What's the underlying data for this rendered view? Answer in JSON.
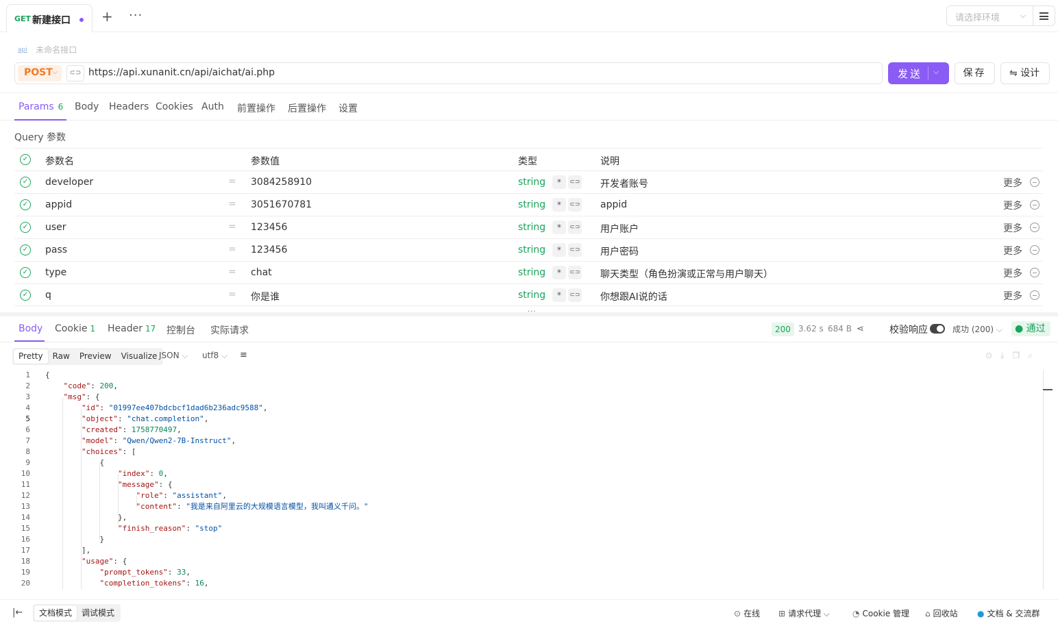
{
  "top_tabs": {
    "active": {
      "method": "GET",
      "title": "新建接口"
    },
    "add": "+",
    "more": "···"
  },
  "environment": {
    "placeholder": "请选择环境"
  },
  "api_name": {
    "tag": "api",
    "placeholder": "未命名接口"
  },
  "request": {
    "method": "POST",
    "url": "https://api.xunanit.cn/api/aichat/ai.php",
    "send_label": "发送",
    "save_label": "保存",
    "design_label": "⇋ 设计"
  },
  "param_tabs": [
    {
      "label": "Params",
      "count": "6"
    },
    {
      "label": "Body"
    },
    {
      "label": "Headers"
    },
    {
      "label": "Cookies"
    },
    {
      "label": "Auth"
    },
    {
      "label": "前置操作"
    },
    {
      "label": "后置操作"
    },
    {
      "label": "设置"
    }
  ],
  "query": {
    "title": "Query 参数",
    "headers": {
      "name": "参数名",
      "value": "参数值",
      "type": "类型",
      "desc": "说明"
    },
    "more_label": "更多",
    "rows": [
      {
        "name": "developer",
        "value": "3084258910",
        "type": "string",
        "desc": "开发者账号"
      },
      {
        "name": "appid",
        "value": "3051670781",
        "type": "string",
        "desc": "appid"
      },
      {
        "name": "user",
        "value": "123456",
        "type": "string",
        "desc": "用户账户"
      },
      {
        "name": "pass",
        "value": "123456",
        "type": "string",
        "desc": "用户密码"
      },
      {
        "name": "type",
        "value": "chat",
        "type": "string",
        "desc": "聊天类型（角色扮演或正常与用户聊天）"
      },
      {
        "name": "q",
        "value": "你是谁",
        "type": "string",
        "desc": "你想跟AI说的话"
      }
    ]
  },
  "response_tabs": [
    {
      "label": "Body"
    },
    {
      "label": "Cookie",
      "count": "1"
    },
    {
      "label": "Header",
      "count": "17"
    },
    {
      "label": "控制台"
    },
    {
      "label": "实际请求"
    }
  ],
  "response_meta": {
    "status": "200",
    "time": "3.62 s",
    "size": "684 B",
    "validate_label": "校验响应",
    "success_select": "成功 (200)",
    "pass_label": "通过"
  },
  "view_modes": [
    "Pretty",
    "Raw",
    "Preview",
    "Visualize"
  ],
  "format": "JSON",
  "encoding": "utf8",
  "code_lines": [
    "{",
    "    \"code\": 200,",
    "    \"msg\": {",
    "        \"id\": \"01997ee407bdcbcf1dad6b236adc9588\",",
    "        \"object\": \"chat.completion\",",
    "        \"created\": 1758770497,",
    "        \"model\": \"Qwen/Qwen2-7B-Instruct\",",
    "        \"choices\": [",
    "            {",
    "                \"index\": 0,",
    "                \"message\": {",
    "                    \"role\": \"assistant\",",
    "                    \"content\": \"我是来自阿里云的大规模语言模型，我叫通义千问。\"",
    "                },",
    "                \"finish_reason\": \"stop\"",
    "            }",
    "        ],",
    "        \"usage\": {",
    "            \"prompt_tokens\": 33,",
    "            \"completion_tokens\": 16,"
  ],
  "footer": {
    "modes": [
      "文档模式",
      "调试模式"
    ],
    "online": "在线",
    "proxy": "请求代理",
    "cookie_mgmt": "Cookie 管理",
    "recycle": "回收站",
    "docs": "文档 & 交流群"
  }
}
